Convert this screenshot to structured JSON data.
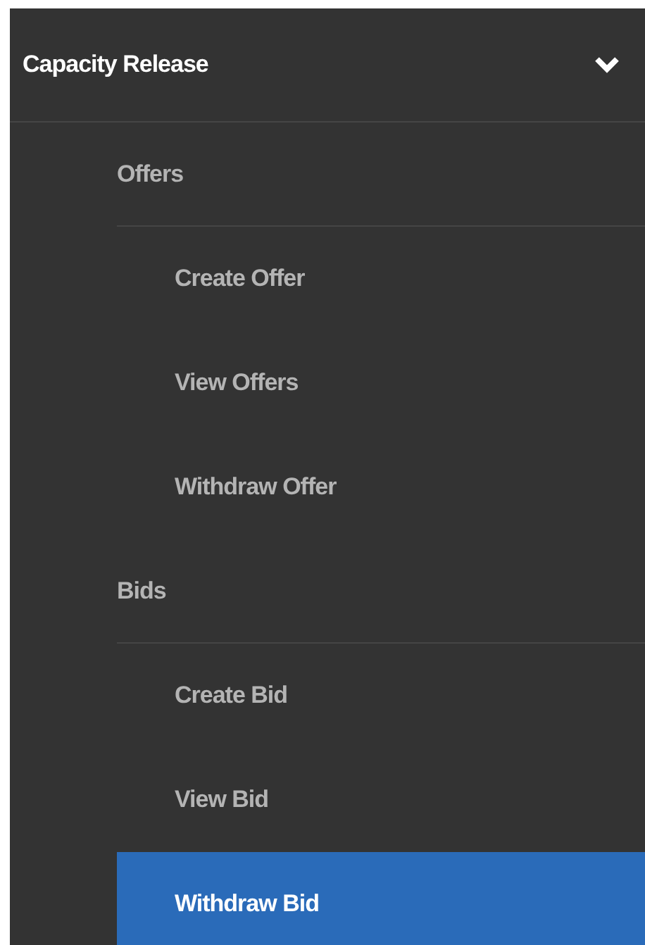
{
  "menu": {
    "title": "Capacity Release",
    "expanded": true,
    "groups": [
      {
        "label": "Offers",
        "items": [
          {
            "label": "Create Offer",
            "selected": false
          },
          {
            "label": "View Offers",
            "selected": false
          },
          {
            "label": "Withdraw Offer",
            "selected": false
          }
        ]
      },
      {
        "label": "Bids",
        "items": [
          {
            "label": "Create Bid",
            "selected": false
          },
          {
            "label": "View Bid",
            "selected": false
          },
          {
            "label": "Withdraw Bid",
            "selected": true
          }
        ]
      }
    ]
  }
}
